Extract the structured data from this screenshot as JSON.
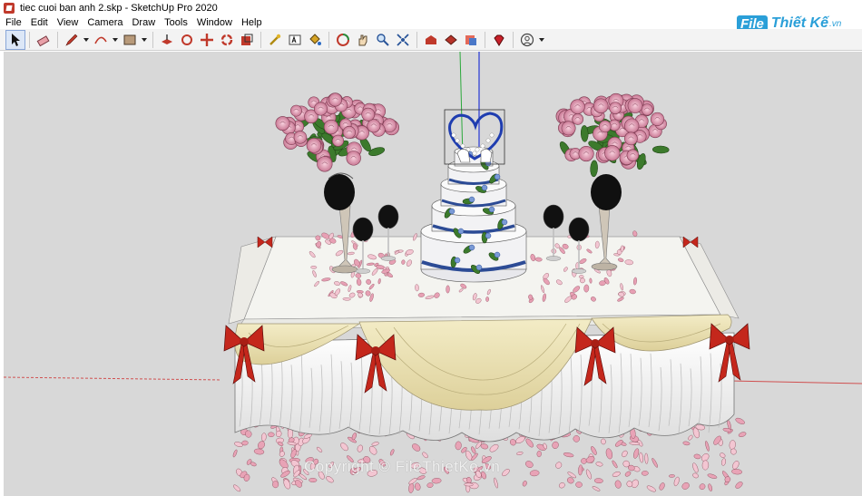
{
  "window": {
    "title": "tiec cuoi ban anh 2.skp - SketchUp Pro 2020"
  },
  "menu": [
    "File",
    "Edit",
    "View",
    "Camera",
    "Draw",
    "Tools",
    "Window",
    "Help"
  ],
  "brand": {
    "box": "File",
    "text": "Thiết Kế",
    "suffix": ".vn"
  },
  "watermark": "Copyright © FileThietKe.vn",
  "toolbar_icons": [
    "select-icon",
    "eraser-icon",
    "pencil-icon",
    "arc-icon",
    "shape-icon",
    "push-pull-icon",
    "move-icon",
    "rotate-icon",
    "scale-icon",
    "offset-icon",
    "tape-measure-icon",
    "text-icon",
    "paint-bucket-icon",
    "orbit-icon",
    "pan-icon",
    "zoom-icon",
    "zoom-extents-icon",
    "warehouse-icon",
    "extension-warehouse-icon",
    "send-to-layout-icon",
    "ruby-icon",
    "account-icon"
  ],
  "colors": {
    "sky": "#d8d8d8",
    "tablecloth": "#f4f4f0",
    "drape": "#ece3b5",
    "bow": "#c4271c",
    "rose": "#e9a7bb",
    "leaf": "#3c7a2c",
    "cake_band": "#2c4b95"
  }
}
